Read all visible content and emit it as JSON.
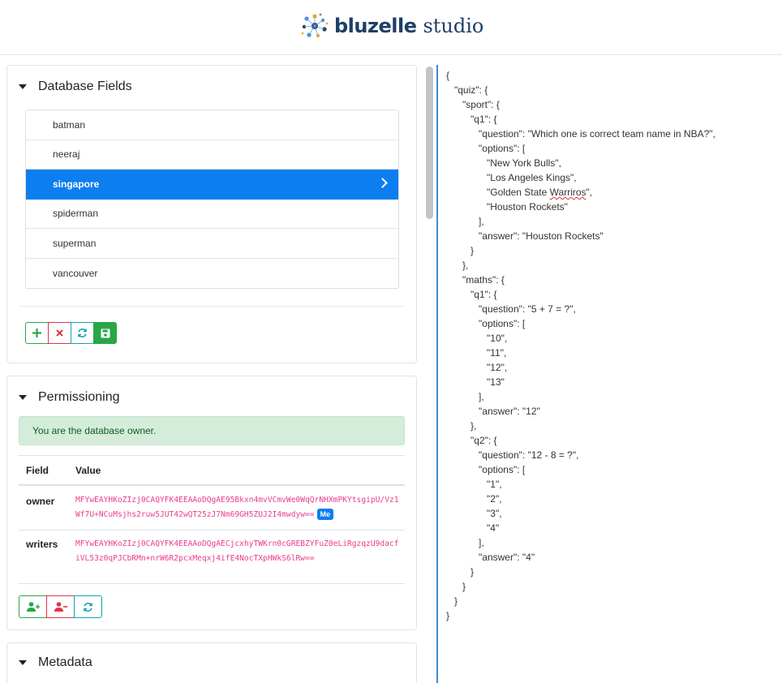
{
  "header": {
    "brand": "bluzelle",
    "product": "studio"
  },
  "database_fields": {
    "title": "Database Fields",
    "items": [
      {
        "label": "batman",
        "selected": false
      },
      {
        "label": "neeraj",
        "selected": false
      },
      {
        "label": "singapore",
        "selected": true
      },
      {
        "label": "spiderman",
        "selected": false
      },
      {
        "label": "superman",
        "selected": false
      },
      {
        "label": "vancouver",
        "selected": false
      }
    ],
    "actions": [
      "add",
      "delete",
      "refresh",
      "save"
    ]
  },
  "permissioning": {
    "title": "Permissioning",
    "alert": "You are the database owner.",
    "columns": {
      "field": "Field",
      "value": "Value"
    },
    "rows": {
      "owner": {
        "field": "owner",
        "value": "MFYwEAYHKoZIzj0CAQYFK4EEAAoDQgAE95Bkxn4mvVCmvWe0WqQrNHXmPKYtsgipU/Vz1Wf7U+NCuMsjhs2ruw5JUT42wQT25zJ7Nm69GH5ZUJ2I4mwdyw==",
        "badge": "Me"
      },
      "writers": {
        "field": "writers",
        "value": "MFYwEAYHKoZIzj0CAQYFK4EEAAoDQgAECjcxhyTWKrn0cGREBZYFuZ0eLiRgzqzU9dacfiVL53z0qPJCbRMn+nrW6R2pcxMeqxj4ifE4NocTXpHWkS6lRw=="
      }
    },
    "actions": [
      "add-writer",
      "remove-writer",
      "refresh"
    ]
  },
  "metadata": {
    "title": "Metadata"
  },
  "json_view": {
    "lines": [
      "{",
      "   \"quiz\": {",
      "      \"sport\": {",
      "         \"q1\": {",
      "            \"question\": \"Which one is correct team name in NBA?\",",
      "            \"options\": [",
      "               \"New York Bulls\",",
      "               \"Los Angeles Kings\",",
      "               \"Golden State Warriros\",",
      "               \"Houston Rockets\"",
      "            ],",
      "            \"answer\": \"Houston Rockets\"",
      "         }",
      "      },",
      "      \"maths\": {",
      "         \"q1\": {",
      "            \"question\": \"5 + 7 = ?\",",
      "            \"options\": [",
      "               \"10\",",
      "               \"11\",",
      "               \"12\",",
      "               \"13\"",
      "            ],",
      "            \"answer\": \"12\"",
      "         },",
      "         \"q2\": {",
      "            \"question\": \"12 - 8 = ?\",",
      "            \"options\": [",
      "               \"1\",",
      "               \"2\",",
      "               \"3\",",
      "               \"4\"",
      "            ],",
      "            \"answer\": \"4\"",
      "         }",
      "      }",
      "   }",
      "}"
    ]
  },
  "colors": {
    "accent": "#0d7ef0",
    "success": "#28a745",
    "danger": "#dc3545",
    "info": "#17a2b8",
    "key_text": "#e83e8c"
  }
}
